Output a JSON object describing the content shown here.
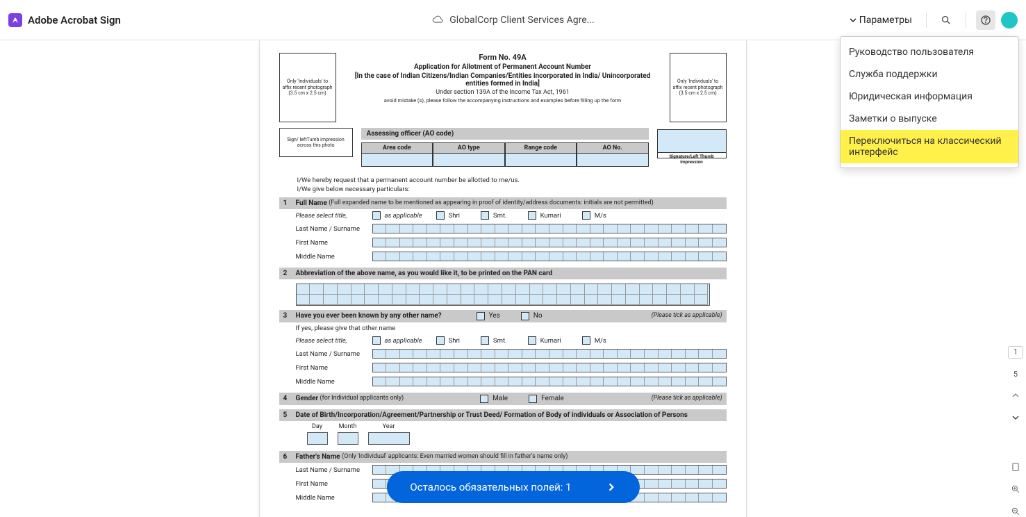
{
  "brand": "Adobe Acrobat Sign",
  "documentTitle": "GlobalCorp Client Services Agre...",
  "paramsLabel": "Параметры",
  "helpMenu": {
    "items": [
      "Руководство пользователя",
      "Служба поддержки",
      "Юридическая информация",
      "Заметки о выпуске",
      "Переключиться на классический интерфейс"
    ]
  },
  "pagination": {
    "current": "1",
    "total": "5"
  },
  "actionBar": {
    "text": "Осталось обязательных полей: 1"
  },
  "form": {
    "formNo": "Form No. 49A",
    "title": "Application for Allotment of Permanent Account Number",
    "subtitle": "[In the  case of Indian Citizens/Indian Companies/Entities incorporated in India/ Unincorporated entities formed in India]",
    "section": "Under section 139A of the Income Tax Act, 1961",
    "instr": "avoid mistake (s), please follow the accompanying instructions and examples before filling up the form",
    "photoNote": "Only 'Individuals' to affix recent photograph (3.5 cm x 2.5 cm)",
    "signNote": "Sign/ leftTumb impression across this photo",
    "sigLabel": "Signature/Left Thumb impression",
    "aoHeader": "Assessing officer  (AO code)",
    "aoCols": [
      "Area code",
      "AO type",
      "Range code",
      "AO No."
    ],
    "intro1": "I/We hereby request that a permanent account number be allotted to me/us.",
    "intro2": "I/We give below necessary particulars:",
    "s1": {
      "title": "Full Name",
      "hint": "(Full expanded name to be mentioned as appearing in proof of identity/address documents: initials are not permitted)"
    },
    "selectTitle": "Please select title,",
    "asApplicable": "as applicable",
    "titles": [
      "Shri",
      "Smt.",
      "Kumari",
      "M/s"
    ],
    "lastName": "Last Name / Surname",
    "firstName": "First Name",
    "middleName": "Middle Name",
    "s2": {
      "title": "Abbreviation of the above name, as you would like it, to be printed on the PAN card"
    },
    "s3": {
      "title": "Have you ever been known by any other name?",
      "yes": "Yes",
      "no": "No",
      "tick": "(Please tick as applicable)",
      "ifyes": "If yes, please give that other name"
    },
    "s4": {
      "title": "Gender",
      "hint": "(for Individual applicants only)",
      "male": "Male",
      "female": "Female",
      "tick": "(Please tick as applicable)"
    },
    "s5": {
      "title": "Date of Birth/Incorporation/Agreement/Partnership or Trust Deed/ Formation of Body of individuals or Association of Persons",
      "day": "Day",
      "month": "Month",
      "year": "Year"
    },
    "s6": {
      "title": "Father's Name",
      "hint": "(Only 'Individual' applicants: Even married women should fill in father's name only)"
    }
  }
}
